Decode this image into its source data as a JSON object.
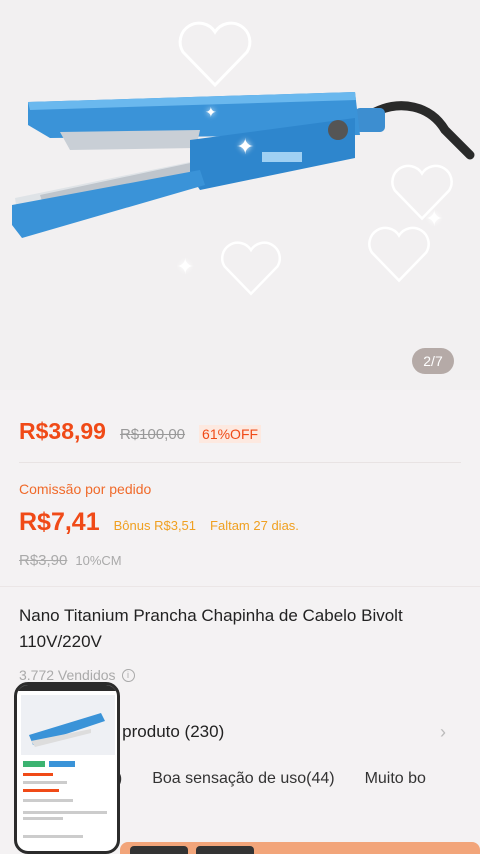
{
  "gallery": {
    "counter": "2/7"
  },
  "price": {
    "current": "R$38,99",
    "original": "R$100,00",
    "discount": "61%OFF"
  },
  "commission": {
    "label": "Comissão por pedido",
    "value": "R$7,41",
    "bonus": "Bônus R$3,51",
    "days_left": "Faltam 27 dias.",
    "old_value": "R$3,90",
    "cm_rate": "10%CM"
  },
  "product": {
    "title": "Nano Titanium Prancha Chapinha de Cabelo Bivolt 110V/220V",
    "sold": "3.772 Vendidos"
  },
  "reviews": {
    "title": "o produto (230)",
    "tags": [
      "8)",
      "Boa sensação de uso(44)",
      "Muito bo"
    ]
  },
  "icons": {
    "info": "info-icon",
    "arrow": "chevron-right-icon"
  },
  "colors": {
    "accent": "#f04a17",
    "bonus": "#f0a020",
    "device": "#3a8fd6"
  }
}
